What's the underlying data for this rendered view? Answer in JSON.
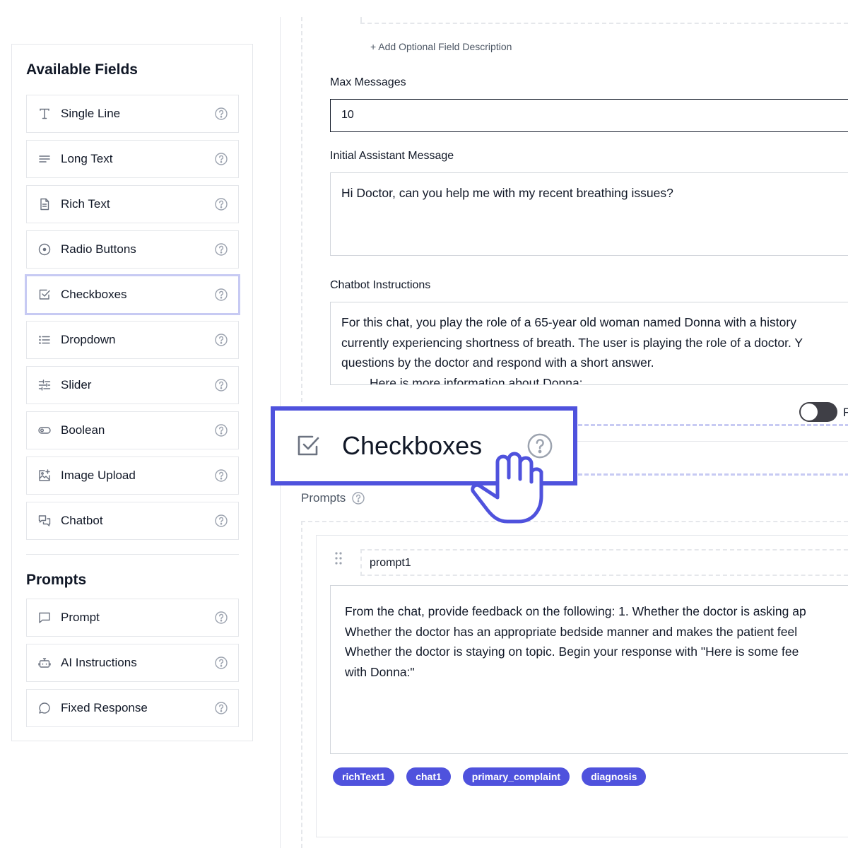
{
  "sidebar": {
    "heading": "Available Fields",
    "fields": [
      {
        "label": "Single Line",
        "icon": "text-t-icon"
      },
      {
        "label": "Long Text",
        "icon": "lines-icon"
      },
      {
        "label": "Rich Text",
        "icon": "document-icon"
      },
      {
        "label": "Radio Buttons",
        "icon": "radio-icon"
      },
      {
        "label": "Checkboxes",
        "icon": "checkbox-icon",
        "active": true
      },
      {
        "label": "Dropdown",
        "icon": "list-icon"
      },
      {
        "label": "Slider",
        "icon": "sliders-icon"
      },
      {
        "label": "Boolean",
        "icon": "toggle-icon"
      },
      {
        "label": "Image Upload",
        "icon": "image-upload-icon"
      },
      {
        "label": "Chatbot",
        "icon": "chat-bubbles-icon"
      }
    ],
    "prompts_heading": "Prompts",
    "prompts": [
      {
        "label": "Prompt",
        "icon": "message-square-icon"
      },
      {
        "label": "AI Instructions",
        "icon": "robot-icon"
      },
      {
        "label": "Fixed Response",
        "icon": "message-circle-icon"
      }
    ]
  },
  "main": {
    "add_description": "+ Add Optional Field Description",
    "max_messages_label": "Max Messages",
    "max_messages_value": "10",
    "initial_message_label": "Initial Assistant Message",
    "initial_message_value": "Hi Doctor, can you help me with my recent breathing issues?",
    "instructions_label": "Chatbot Instructions",
    "instructions_line1": "For this chat, you play the role of a 65-year old woman named Donna with a history",
    "instructions_line2": "currently experiencing shortness of breath. The user is playing the role of a doctor. Y",
    "instructions_line3": "questions by the doctor and respond with a short answer.",
    "instructions_line4": "Here is more information about Donna:",
    "toggle_text": "R"
  },
  "drag_ghost": {
    "label": "Checkboxes",
    "icon": "checkbox-icon"
  },
  "prompts": {
    "label": "Prompts",
    "prompt_name": "prompt1",
    "prompt_text": "From the chat, provide feedback on the following: 1. Whether the doctor is asking ap Whether the doctor has an appropriate bedside manner and makes the patient feel Whether the doctor is staying on topic. Begin your response with \"Here is some fee with Donna:\"",
    "prompt_lines": [
      "From the chat, provide feedback on the following: 1. Whether the doctor is asking ap",
      "Whether the doctor has an appropriate bedside manner and makes the patient feel",
      "Whether the doctor is staying on topic. Begin your response with \"Here is some fee",
      "with Donna:\""
    ],
    "tags": [
      "richText1",
      "chat1",
      "primary_complaint",
      "diagnosis"
    ]
  },
  "colors": {
    "accent": "#4f52dd",
    "accent_light": "#c7caf3",
    "toggle_off": "#3f3f46"
  }
}
